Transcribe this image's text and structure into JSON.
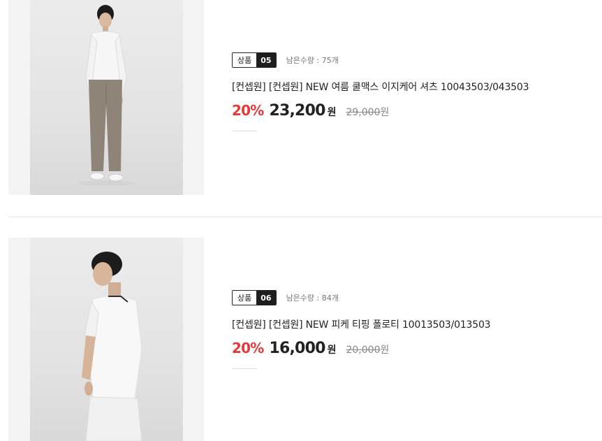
{
  "products": [
    {
      "badge_label": "상품",
      "badge_number": "05",
      "stock": "남은수량 : 75개",
      "title": "[컨셉원] [컨셉원] NEW 여름 쿨맥스 이지케어 셔츠 10043503/043503",
      "discount": "20%",
      "price": "23,200",
      "currency": "원",
      "original_price": "29,000",
      "original_currency": "원",
      "image": "man-white-shirt-grey-trousers-photo"
    },
    {
      "badge_label": "상품",
      "badge_number": "06",
      "stock": "남은수량 : 84개",
      "title": "[컨셉원] [컨셉원] NEW 피케 티핑 폴로티 10013503/013503",
      "discount": "20%",
      "price": "16,000",
      "currency": "원",
      "original_price": "20,000",
      "original_currency": "원",
      "image": "man-white-polo-photo"
    }
  ],
  "colors": {
    "discount": "#e43a3a",
    "badge_dark": "#1e1e1e",
    "thumb_bg": "#f4f4f4"
  }
}
